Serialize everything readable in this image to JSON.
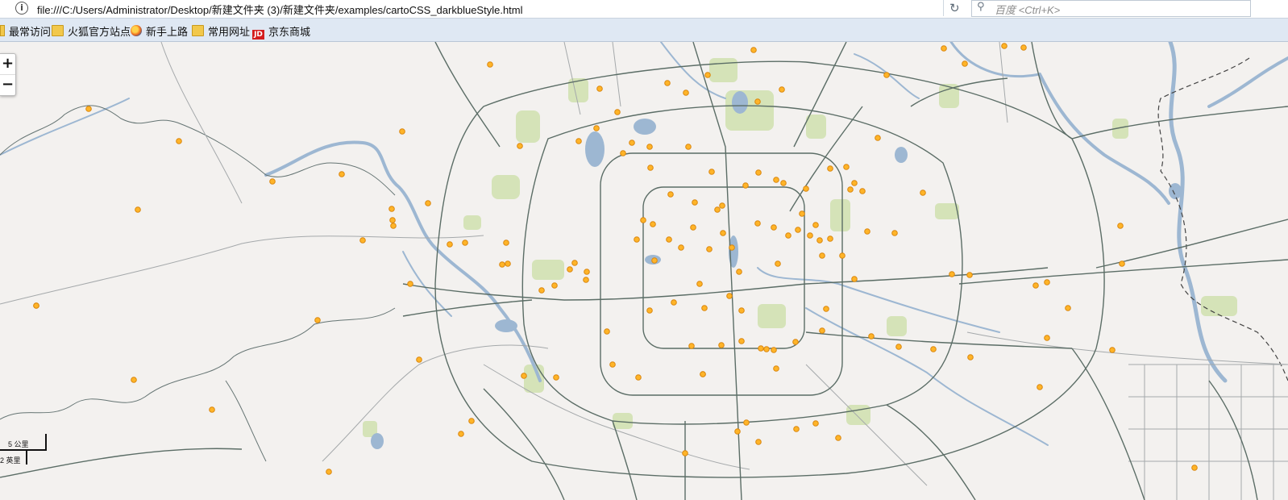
{
  "browser": {
    "url": "file:///C:/Users/Administrator/Desktop/新建文件夹 (3)/新建文件夹/examples/cartoCSS_darkblueStyle.html",
    "search_placeholder": "百度 <Ctrl+K>"
  },
  "bookmarks": [
    {
      "label": "最常访问",
      "icon": "partial-icon"
    },
    {
      "label": "火狐官方站点",
      "icon": "folder-icon"
    },
    {
      "label": "新手上路",
      "icon": "firefox-icon"
    },
    {
      "label": "常用网址",
      "icon": "folder-icon"
    },
    {
      "label": "京东商城",
      "icon": "jd-icon"
    }
  ],
  "map": {
    "zoom_in": "+",
    "zoom_out": "−",
    "scale_km": "5 公里",
    "scale_mi": "2 英里",
    "colors": {
      "background": "#f3f1ef",
      "road_major": "#5b6d66",
      "road_minor": "#9aa0a3",
      "water": "#9db7d2",
      "park": "#d5e3b8",
      "poi_fill": "#ffb428",
      "poi_stroke": "#d9860e"
    }
  }
}
